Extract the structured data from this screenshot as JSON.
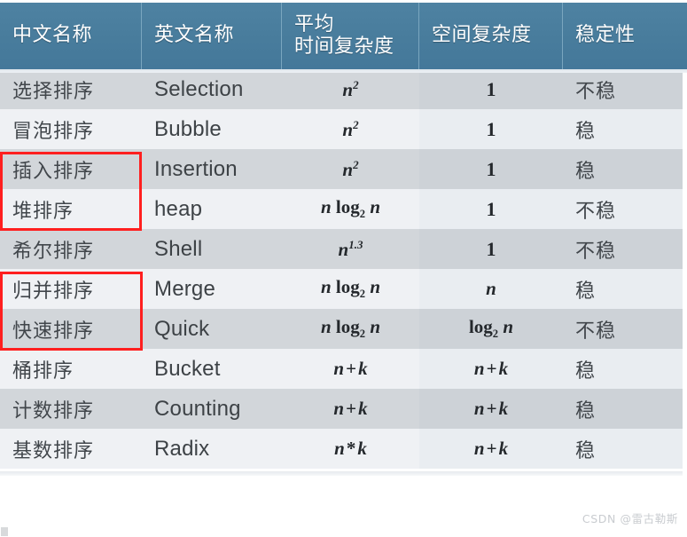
{
  "table": {
    "headers": [
      {
        "text": "中文名称",
        "lines": [
          "中文名称"
        ]
      },
      {
        "text": "英文名称",
        "lines": [
          "英文名称"
        ]
      },
      {
        "text": "平均时间复杂度",
        "lines": [
          "平均",
          "时间复杂度"
        ]
      },
      {
        "text": "空间复杂度",
        "lines": [
          "空间复杂度"
        ]
      },
      {
        "text": "稳定性",
        "lines": [
          "稳定性"
        ]
      }
    ],
    "rows": [
      {
        "cn": "选择排序",
        "en": "Selection",
        "time": "n²",
        "space": "1",
        "stable": "不稳"
      },
      {
        "cn": "冒泡排序",
        "en": "Bubble",
        "time": "n²",
        "space": "1",
        "stable": "稳"
      },
      {
        "cn": "插入排序",
        "en": "Insertion",
        "time": "n²",
        "space": "1",
        "stable": "稳"
      },
      {
        "cn": "堆排序",
        "en": "heap",
        "time": "n log₂ n",
        "space": "1",
        "stable": "不稳"
      },
      {
        "cn": "希尔排序",
        "en": "Shell",
        "time": "n^1.3",
        "space": "1",
        "stable": "不稳"
      },
      {
        "cn": "归并排序",
        "en": "Merge",
        "time": "n log₂ n",
        "space": "n",
        "stable": "稳"
      },
      {
        "cn": "快速排序",
        "en": "Quick",
        "time": "n log₂ n",
        "space": "log₂ n",
        "stable": "不稳"
      },
      {
        "cn": "桶排序",
        "en": "Bucket",
        "time": "n + k",
        "space": "n + k",
        "stable": "稳"
      },
      {
        "cn": "计数排序",
        "en": "Counting",
        "time": "n + k",
        "space": "n + k",
        "stable": "稳"
      },
      {
        "cn": "基数排序",
        "en": "Radix",
        "time": "n * k",
        "space": "n + k",
        "stable": "稳"
      }
    ]
  },
  "annotations": {
    "box_1_label": "插入排序-堆排序-highlight",
    "box_2_label": "归并排序-快速排序-highlight",
    "box_color": "#ff1f1f"
  },
  "watermark": {
    "text": "CSDN @雷古勒斯"
  },
  "colors": {
    "header_bg": "#487c9c",
    "row_band_a": "#d2d6da",
    "row_band_b": "#eff1f4",
    "text": "#43484d"
  }
}
